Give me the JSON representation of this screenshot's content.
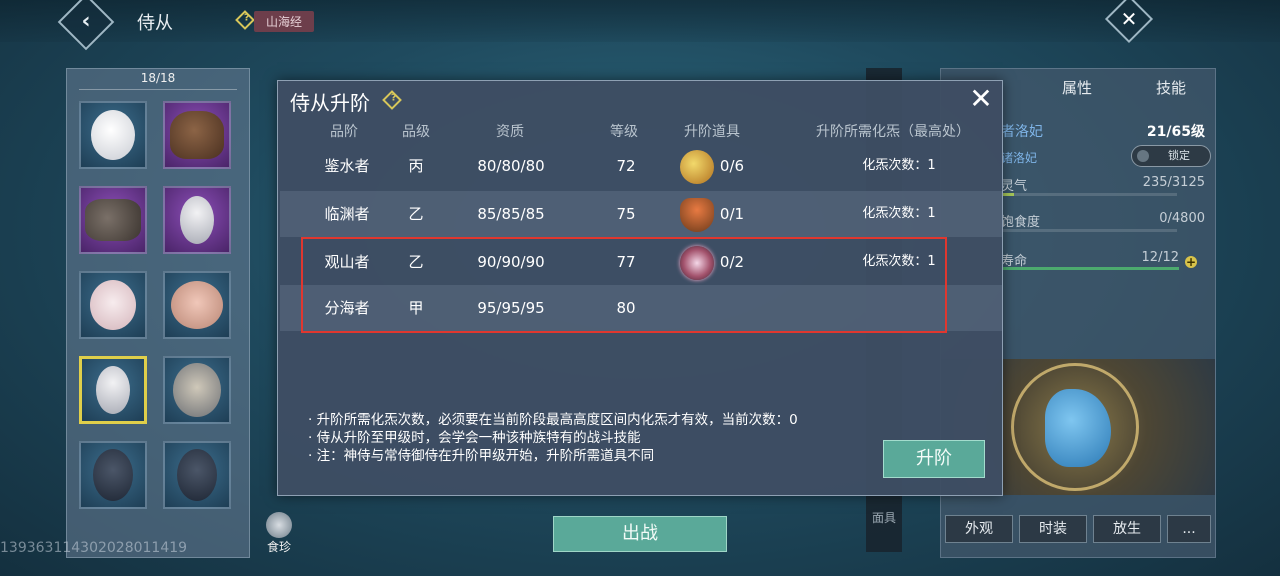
{
  "header": {
    "title": "侍从",
    "help": "?",
    "tag": "山海经"
  },
  "left": {
    "count": "18/18",
    "pets": [
      {
        "art": "art-white",
        "frame": "",
        "name": "companion-white-doll"
      },
      {
        "art": "art-capy",
        "frame": "purple",
        "name": "companion-capybara"
      },
      {
        "art": "art-rhino",
        "frame": "purple",
        "name": "companion-rhino"
      },
      {
        "art": "art-ghost",
        "frame": "purple",
        "name": "companion-ghost-cat"
      },
      {
        "art": "art-girl",
        "frame": "",
        "name": "companion-white-girl"
      },
      {
        "art": "art-mouse",
        "frame": "",
        "name": "companion-mouse"
      },
      {
        "art": "art-ghost",
        "frame": "selected",
        "name": "companion-ghost-cat-selected"
      },
      {
        "art": "art-elf",
        "frame": "",
        "name": "companion-elf"
      },
      {
        "art": "art-cat",
        "frame": "",
        "name": "companion-dark-cat-1"
      },
      {
        "art": "art-cat",
        "frame": "",
        "name": "companion-dark-cat-2"
      }
    ],
    "shizhen_label": "食珍",
    "uid": "1393631143020280114​19"
  },
  "modal": {
    "title": "侍从升阶",
    "help": "?",
    "close": "✕",
    "columns": [
      "品阶",
      "品级",
      "资质",
      "等级",
      "升阶道具",
      "升阶所需化炁（最高处）"
    ],
    "rows": [
      {
        "rank": "鉴水者",
        "grade": "丙",
        "aptitude": "80/80/80",
        "level": "72",
        "item_icon": "fruit-icon",
        "item_count": "0/6",
        "req": "化炁次数：1"
      },
      {
        "rank": "临渊者",
        "grade": "乙",
        "aptitude": "85/85/85",
        "level": "75",
        "item_icon": "bowl-icon",
        "item_count": "0/1",
        "req": "化炁次数：1"
      },
      {
        "rank": "观山者",
        "grade": "乙",
        "aptitude": "90/90/90",
        "level": "77",
        "item_icon": "orb-icon",
        "item_count": "0/2",
        "req": "化炁次数：1"
      },
      {
        "rank": "分海者",
        "grade": "甲",
        "aptitude": "95/95/95",
        "level": "80",
        "item_icon": "",
        "item_count": "",
        "req": ""
      }
    ],
    "notes": [
      "· 升阶所需化炁次数，必须要在当前阶段最高高度区间内化炁才有效，当前次数：0",
      "· 侍从升阶至甲级时，会学会一种该种族特有的战斗技能",
      "· 注：神侍与常侍御侍在升阶甲级开始，升阶所需道具不同"
    ],
    "upgrade_label": "升阶"
  },
  "right": {
    "tabs": [
      "属性",
      "技能"
    ],
    "name_partial": "者洛妃",
    "level": "21/65级",
    "sub_name": "诸洛妃",
    "lock_label": "锁定",
    "stats": [
      {
        "label": "灵气",
        "value": "235/3125",
        "fill": 0.075
      },
      {
        "label": "饱食度",
        "value": "0/4800",
        "fill": 0
      },
      {
        "label": "寿命",
        "value": "12/12",
        "fill": 1
      }
    ],
    "plus": "+",
    "buttons": [
      "外观",
      "时装",
      "放生",
      "..."
    ]
  },
  "bottom": {
    "deploy_label": "出战",
    "mask_label": "面具"
  },
  "colors": {
    "accent_teal": "#5aa999",
    "highlight_red": "#e0372f",
    "selected_gold": "#e0cf4a"
  }
}
